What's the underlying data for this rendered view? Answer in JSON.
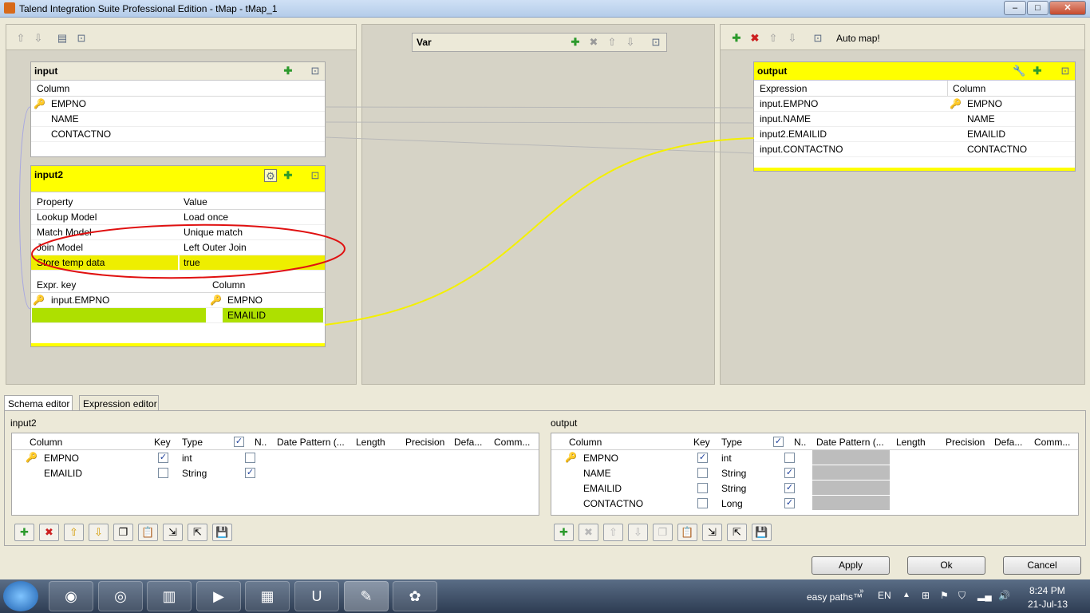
{
  "window": {
    "title": "Talend Integration Suite Professional Edition - tMap - tMap_1"
  },
  "left_pane": {
    "input": {
      "name": "input",
      "column_header": "Column",
      "rows": [
        "EMPNO",
        "NAME",
        "CONTACTNO"
      ]
    },
    "input2": {
      "name": "input2",
      "property_header": "Property",
      "value_header": "Value",
      "properties": [
        {
          "property": "Lookup Model",
          "value": "Load once"
        },
        {
          "property": "Match Model",
          "value": "Unique match"
        },
        {
          "property": "Join Model",
          "value": "Left Outer Join"
        },
        {
          "property": "Store temp data",
          "value": "true"
        }
      ],
      "expr_key_header": "Expr. key",
      "column_header": "Column",
      "key_rows": [
        {
          "expr": "input.EMPNO",
          "column": "EMPNO"
        },
        {
          "expr": "",
          "column": "EMAILID"
        }
      ]
    }
  },
  "var_pane": {
    "name": "Var"
  },
  "right_pane": {
    "toolbar": {
      "auto_map": "Auto map!"
    },
    "output": {
      "name": "output",
      "expression_header": "Expression",
      "column_header": "Column",
      "rows": [
        {
          "expr": "input.EMPNO",
          "column": "EMPNO"
        },
        {
          "expr": "input.NAME",
          "column": "NAME"
        },
        {
          "expr": "input2.EMAILID",
          "column": "EMAILID"
        },
        {
          "expr": "input.CONTACTNO",
          "column": "CONTACTNO"
        }
      ]
    }
  },
  "bottom": {
    "tabs": [
      "Schema editor",
      "Expression editor"
    ],
    "columns": [
      "Column",
      "Key",
      "Type",
      "N..",
      "Date Pattern (...",
      "Length",
      "Precision",
      "Defa...",
      "Comm..."
    ],
    "input2_label": "input2",
    "input2_rows": [
      {
        "column": "EMPNO",
        "key": true,
        "type": "int",
        "nullable": false
      },
      {
        "column": "EMAILID",
        "key": false,
        "type": "String",
        "nullable": true
      }
    ],
    "output_label": "output",
    "output_rows": [
      {
        "column": "EMPNO",
        "key": true,
        "type": "int",
        "nullable": false
      },
      {
        "column": "NAME",
        "key": false,
        "type": "String",
        "nullable": true
      },
      {
        "column": "EMAILID",
        "key": false,
        "type": "String",
        "nullable": true
      },
      {
        "column": "CONTACTNO",
        "key": false,
        "type": "Long",
        "nullable": true
      }
    ],
    "buttons": {
      "apply": "Apply",
      "ok": "Ok",
      "cancel": "Cancel"
    }
  },
  "taskbar": {
    "easy_paths": "easy paths™",
    "lang": "EN",
    "time": "8:24 PM",
    "date": "21-Jul-13"
  },
  "colors": {
    "highlight_yellow": "#ffff00",
    "lookup_green": "#aee000",
    "annotation_red": "#e01010"
  }
}
